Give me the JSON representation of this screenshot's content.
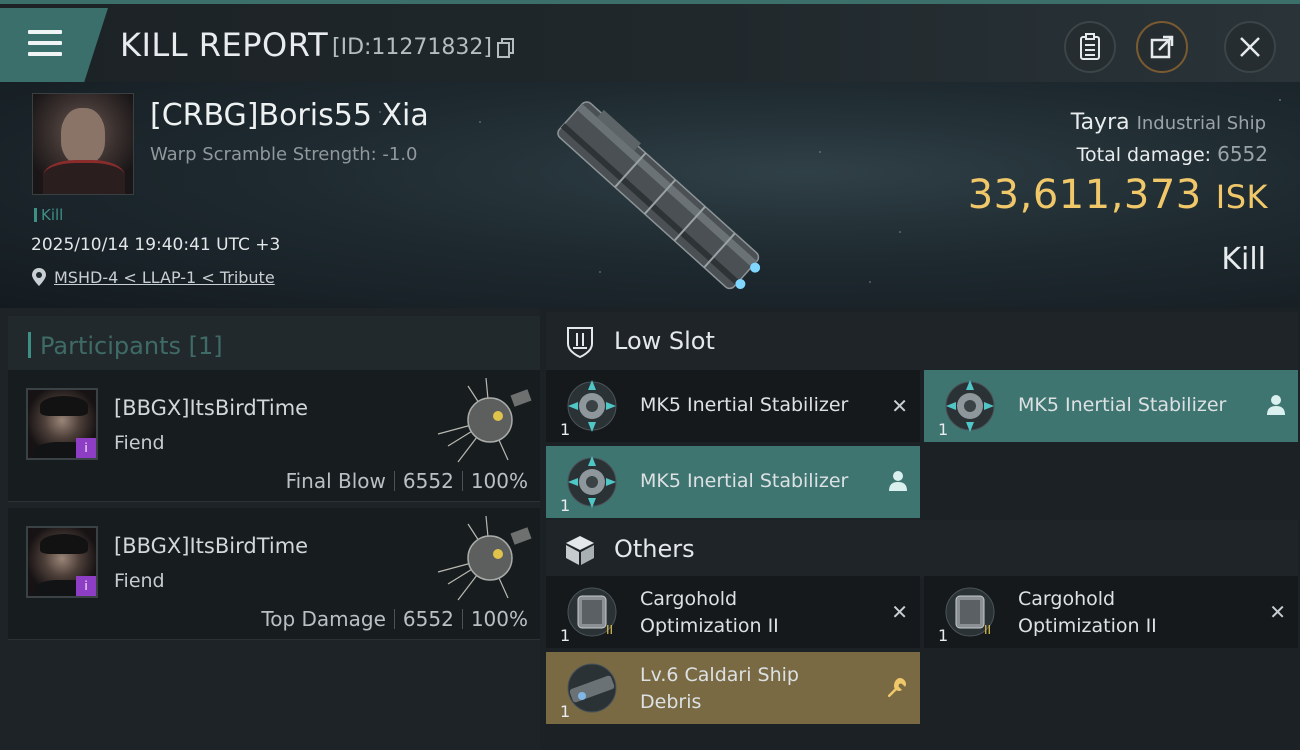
{
  "header": {
    "title": "KILL REPORT",
    "report_id": "[ID:11271832]",
    "icons": [
      "menu-icon",
      "copy-icon",
      "clipboard-icon",
      "share-icon",
      "close-icon"
    ]
  },
  "victim": {
    "name": "[CRBG]Boris55 Xia",
    "warp_scramble": "Warp Scramble Strength: -1.0",
    "tag": "Kill",
    "timestamp": "2025/10/14 19:40:41 UTC +3",
    "location": "MSHD-4 < LLAP-1 < Tribute"
  },
  "ship": {
    "name": "Tayra",
    "class": "Industrial Ship",
    "total_damage_label": "Total damage:",
    "total_damage": "6552",
    "isk_value": "33,611,373",
    "isk_unit": "ISK",
    "result": "Kill"
  },
  "participants": {
    "header": "Participants",
    "count": "[1]",
    "rows": [
      {
        "name": "[BBGX]ItsBirdTime",
        "ship": "Fiend",
        "role": "Final Blow",
        "damage": "6552",
        "percent": "100%",
        "badge": "i"
      },
      {
        "name": "[BBGX]ItsBirdTime",
        "ship": "Fiend",
        "role": "Top Damage",
        "damage": "6552",
        "percent": "100%",
        "badge": "i"
      }
    ]
  },
  "low_slot": {
    "title": "Low Slot",
    "items": [
      {
        "name": "MK5 Inertial Stabilizer",
        "qty": "1",
        "status": "destroyed"
      },
      {
        "name": "MK5 Inertial Stabilizer",
        "qty": "1",
        "status": "dropped"
      },
      {
        "name": "MK5 Inertial Stabilizer",
        "qty": "1",
        "status": "dropped"
      }
    ]
  },
  "others": {
    "title": "Others",
    "items": [
      {
        "name_line1": "Cargohold",
        "name_line2": "Optimization II",
        "qty": "1",
        "status": "destroyed"
      },
      {
        "name_line1": "Cargohold",
        "name_line2": "Optimization II",
        "qty": "1",
        "status": "destroyed"
      },
      {
        "name_line1": "Lv.6 Caldari Ship",
        "name_line2": "Debris",
        "qty": "1",
        "status": "salvage"
      }
    ]
  },
  "colors": {
    "accent_teal": "#3f7570",
    "isk_gold": "#f0c86a",
    "salvage_gold": "#7a6a44",
    "badge_purple": "#8d3ec4"
  }
}
